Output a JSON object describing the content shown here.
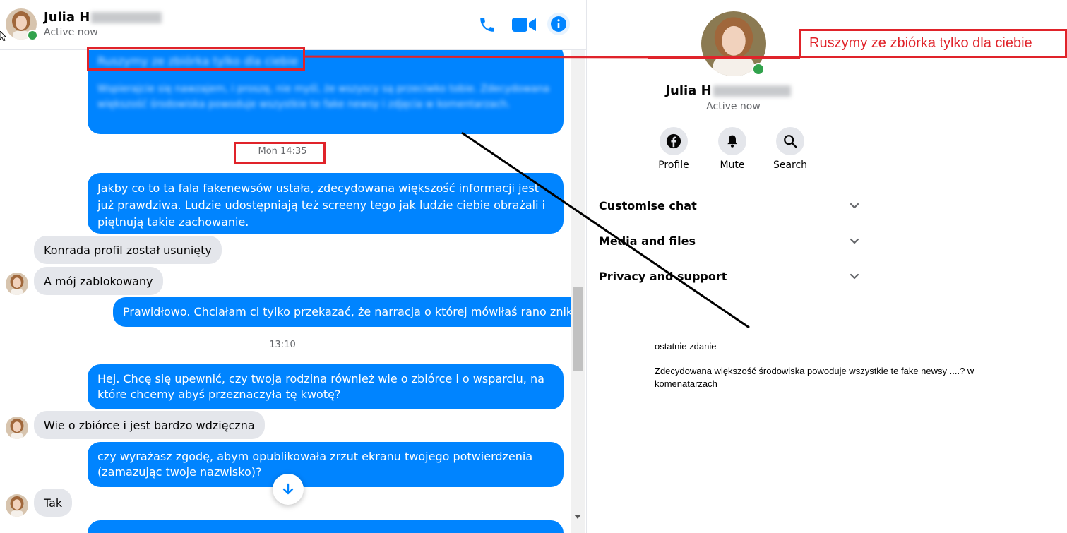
{
  "header": {
    "name_visible": "Julia H",
    "status": "Active now"
  },
  "messages": {
    "blurred_top_line": "Ruszymy ze zbiórka tylko dla ciebie",
    "blurred_body": "Wspierajcie się nawzajem, i proszę, nie myśl, że wszyscy są przeciwko tobie. Zdecydowana większość środowiska powoduje wszystkie te fake newsy i zdjęcia w komentarzach.",
    "time1": "Mon 14:35",
    "msg1": "Jakby co to ta fala fakenewsów ustała, zdecydowana większość informacji jest już prawdziwa. Ludzie udostępniają też screeny tego jak ludzie ciebie obrażali i piętnują takie zachowanie.",
    "in1": "Konrada profil został usunięty",
    "in2": "A mój zablokowany",
    "msg2": "Prawidłowo. Chciałam ci tylko przekazać, że narracja o której mówiłaś rano znika.",
    "time2": "13:10",
    "msg3": "Hej. Chcę się upewnić, czy twoja rodzina również wie o zbiórce i o wsparciu, na które chcemy abyś przeznaczyła tę kwotę?",
    "in3": "Wie o zbiórce i jest bardzo wdzięczna",
    "msg4": "czy wyrażasz zgodę, abym opublikowała zrzut ekranu twojego potwierdzenia (zamazując twoje nazwisko)?",
    "in4": "Tak"
  },
  "info": {
    "name_visible": "Julia H",
    "status": "Active now",
    "actions": [
      {
        "label": "Profile",
        "icon": "facebook-icon"
      },
      {
        "label": "Mute",
        "icon": "bell-icon"
      },
      {
        "label": "Search",
        "icon": "search-icon"
      }
    ],
    "sections": [
      "Customise chat",
      "Media and files",
      "Privacy and support"
    ]
  },
  "annotations": {
    "callout": "Ruszymy ze zbiórka tylko dla ciebie",
    "note_title": "ostatnie zdanie",
    "note_body": "Zdecydowana większość środowiska powoduje wszystkie te fake newsy ....? w komenatarzach"
  },
  "colors": {
    "messenger_blue": "#0084ff",
    "incoming_gray": "#e4e6eb",
    "annotation_red": "#e0232a",
    "online_green": "#31a24c"
  }
}
